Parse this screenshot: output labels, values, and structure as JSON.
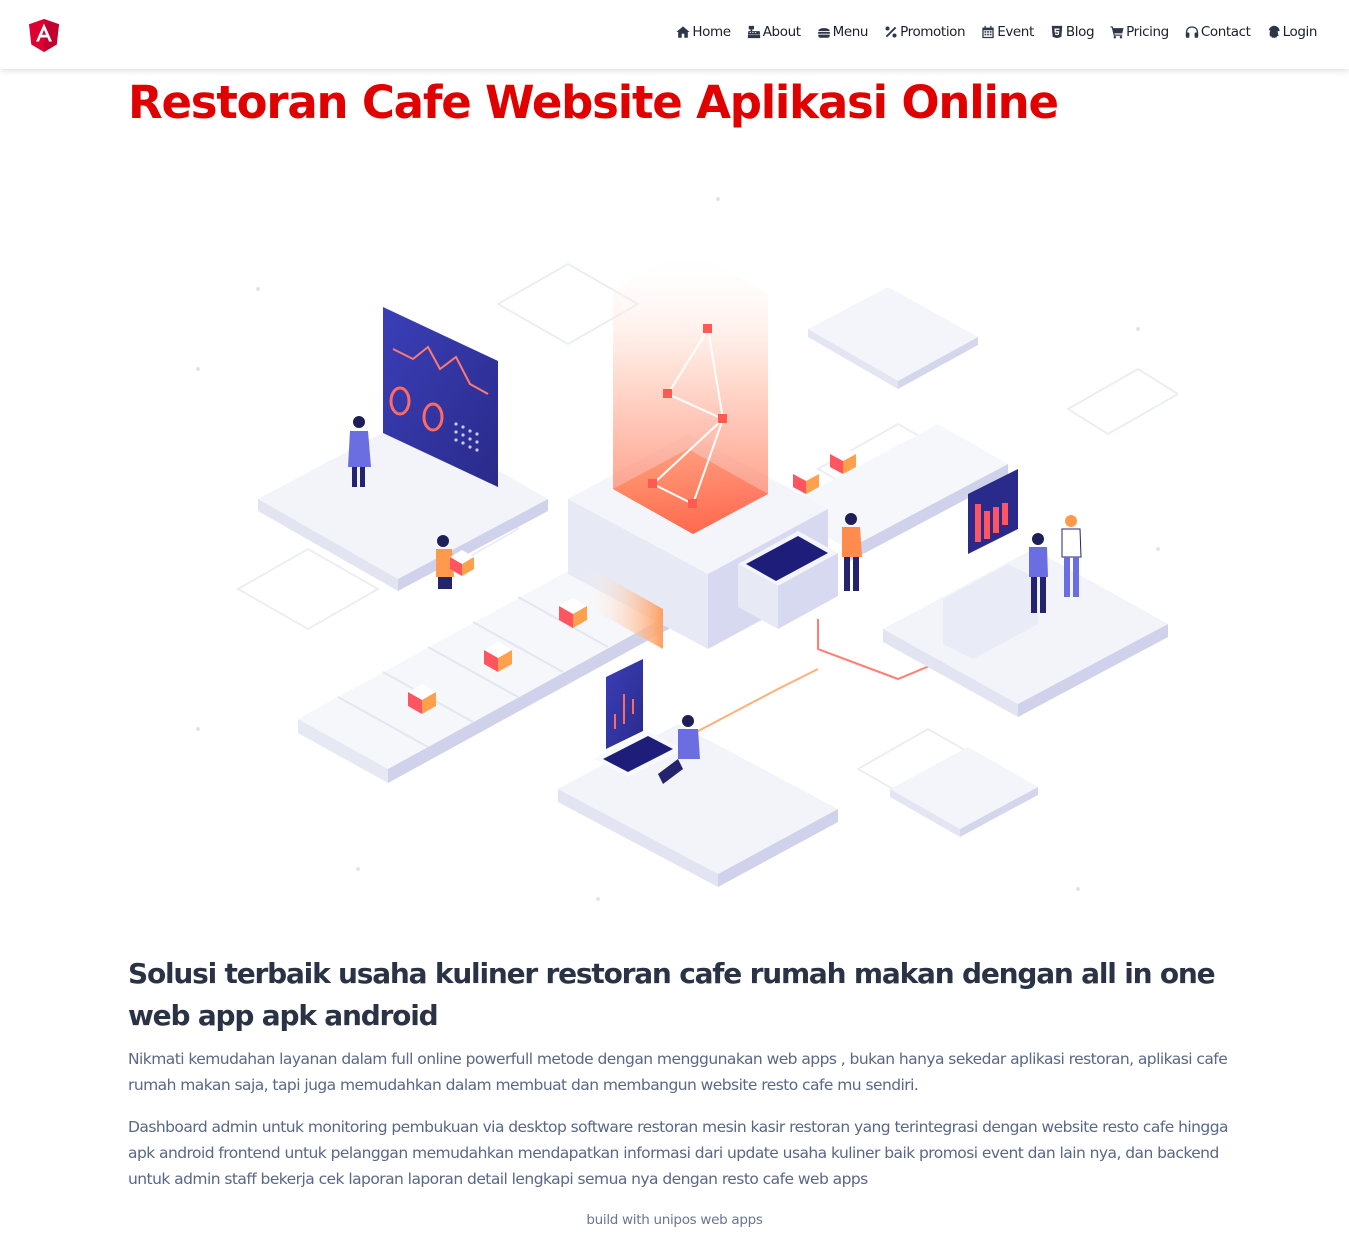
{
  "brand": {
    "logo_icon": "angular-shield-logo",
    "color": "#dd0031"
  },
  "nav": {
    "items": [
      {
        "label": "Home",
        "icon": "home-icon"
      },
      {
        "label": "About",
        "icon": "cash-register-icon"
      },
      {
        "label": "Menu",
        "icon": "hamburger-icon"
      },
      {
        "label": "Promotion",
        "icon": "percent-icon"
      },
      {
        "label": "Event",
        "icon": "calendar-icon"
      },
      {
        "label": "Blog",
        "icon": "html5-icon"
      },
      {
        "label": "Pricing",
        "icon": "shopping-cart-icon"
      },
      {
        "label": "Contact",
        "icon": "headphones-icon"
      },
      {
        "label": "Login",
        "icon": "fingerprint-icon"
      }
    ]
  },
  "hero": {
    "title": "Restoran Cafe Website Aplikasi Online",
    "title_color": "#e00000",
    "image_alt": "Isometric illustration of people working with dashboards, kiosks and data screens around a central glowing machine"
  },
  "content": {
    "subtitle": "Solusi terbaik usaha kuliner restoran cafe rumah makan dengan all in one web app apk android",
    "paragraphs": [
      "Nikmati kemudahan layanan dalam full online powerfull metode dengan menggunakan web apps , bukan hanya sekedar aplikasi restoran, aplikasi cafe rumah makan saja, tapi juga memudahkan dalam membuat dan membangun website resto cafe mu sendiri.",
      "Dashboard admin untuk monitoring pembukuan via desktop software restoran mesin kasir restoran yang terintegrasi dengan website resto cafe hingga apk android frontend untuk pelanggan memudahkan mendapatkan informasi dari update usaha kuliner baik promosi event dan lain nya, dan backend untuk admin staff bekerja cek laporan laporan detail lengkapi semua nya dengan resto cafe web apps"
    ],
    "footer_note": "build with unipos web apps"
  },
  "colors": {
    "accent_red": "#e00000",
    "heading": "#2a3245",
    "body_text": "#5a6785",
    "illustration_navy": "#2f2f9a",
    "illustration_orange": "#ff8a3d"
  }
}
